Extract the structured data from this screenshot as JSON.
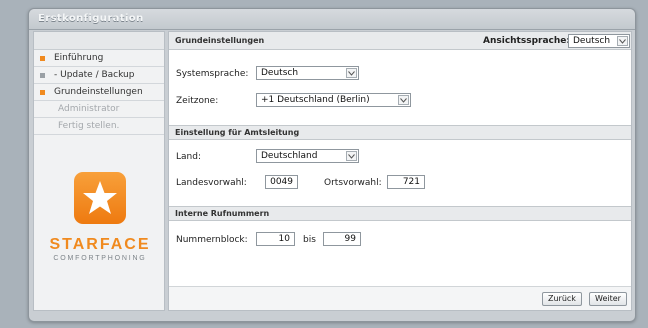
{
  "window": {
    "title": "Erstkonfiguration"
  },
  "sidebar": {
    "items": [
      {
        "label": "Einführung",
        "color": "#f08a1f",
        "state": "done"
      },
      {
        "label": " - Update / Backup",
        "color": "#9aa0a5",
        "state": "done"
      },
      {
        "label": "Grundeinstellungen",
        "color": "#f08a1f",
        "state": "active"
      },
      {
        "label": "Administrator",
        "color": "",
        "state": "disabled"
      },
      {
        "label": "Fertig stellen.",
        "color": "",
        "state": "disabled"
      }
    ],
    "brand": "STARFACE",
    "tagline": "COMFORTPHONING",
    "accent": "#f08a1f"
  },
  "main": {
    "header": "Grundeinstellungen",
    "view_language_label": "Ansichtssprache:",
    "view_language_value": "Deutsch",
    "system_language_label": "Systemsprache:",
    "system_language_value": "Deutsch",
    "timezone_label": "Zeitzone:",
    "timezone_value": "+1 Deutschland (Berlin)",
    "exchange_section": "Einstellung für Amtsleitung",
    "country_label": "Land:",
    "country_value": "Deutschland",
    "country_code_label": "Landesvorwahl:",
    "country_code_value": "0049",
    "area_code_label": "Ortsvorwahl:",
    "area_code_value": "721",
    "internal_section": "Interne Rufnummern",
    "number_block_label": "Nummernblock:",
    "number_from": "10",
    "bis_label": "bis",
    "number_to": "99"
  },
  "footer": {
    "back_label": "Zurück",
    "next_label": "Weiter"
  },
  "icons": {
    "dropdown": "chevron-down-icon",
    "logo": "star-icon"
  }
}
